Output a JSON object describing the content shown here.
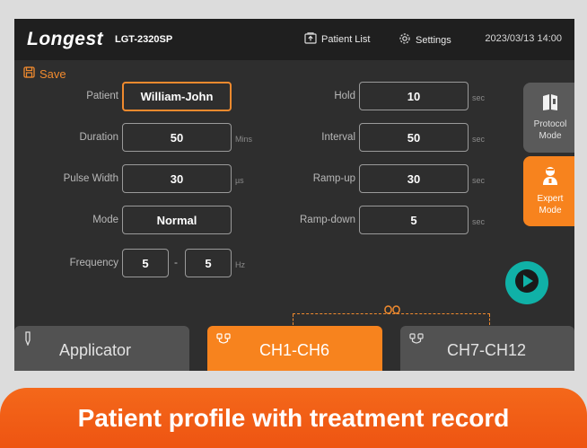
{
  "header": {
    "brand": "Longest",
    "model": "LGT-2320SP",
    "patient_list": "Patient List",
    "settings": "Settings",
    "datetime": "2023/03/13 14:00"
  },
  "toolbar": {
    "save_label": "Save"
  },
  "form_left": {
    "patient": {
      "label": "Patient",
      "value": "William-John"
    },
    "duration": {
      "label": "Duration",
      "value": "50",
      "unit": "Mins"
    },
    "pulse_width": {
      "label": "Pulse Width",
      "value": "30",
      "unit": "µs"
    },
    "mode": {
      "label": "Mode",
      "value": "Normal"
    },
    "frequency": {
      "label": "Frequency",
      "min": "5",
      "max": "5",
      "unit": "Hz"
    }
  },
  "form_right": {
    "hold": {
      "label": "Hold",
      "value": "10",
      "unit": "sec"
    },
    "interval": {
      "label": "Interval",
      "value": "50",
      "unit": "sec"
    },
    "ramp_up": {
      "label": "Ramp-up",
      "value": "30",
      "unit": "sec"
    },
    "ramp_down": {
      "label": "Ramp-down",
      "value": "5",
      "unit": "sec"
    }
  },
  "side": {
    "protocol_line1": "Protocol",
    "protocol_line2": "Mode",
    "expert_line1": "Expert",
    "expert_line2": "Mode"
  },
  "tabs": [
    {
      "label": "Applicator"
    },
    {
      "label": "CH1-CH6"
    },
    {
      "label": "CH7-CH12"
    }
  ],
  "banner": {
    "text": "Patient profile with treatment record"
  },
  "colors": {
    "accent": "#f7831e",
    "play": "#10b1a7",
    "screen": "#2e2e2e",
    "banner": "#ef5a14"
  }
}
